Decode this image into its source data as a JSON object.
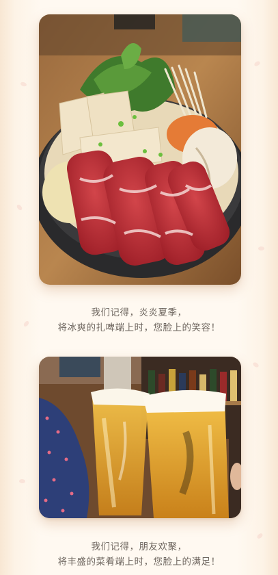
{
  "sections": [
    {
      "photo_icon": "hotpot-photo",
      "caption_line1": "我们记得，炎炎夏季，",
      "caption_line2": "将冰爽的扎啤端上时，您脸上的笑容！"
    },
    {
      "photo_icon": "beer-toast-photo",
      "caption_line1": "我们记得，朋友欢聚，",
      "caption_line2": "将丰盛的菜肴端上时，您脸上的满足！"
    }
  ],
  "colors": {
    "background": "#fdf1e3",
    "caption_text": "#6e665f"
  }
}
